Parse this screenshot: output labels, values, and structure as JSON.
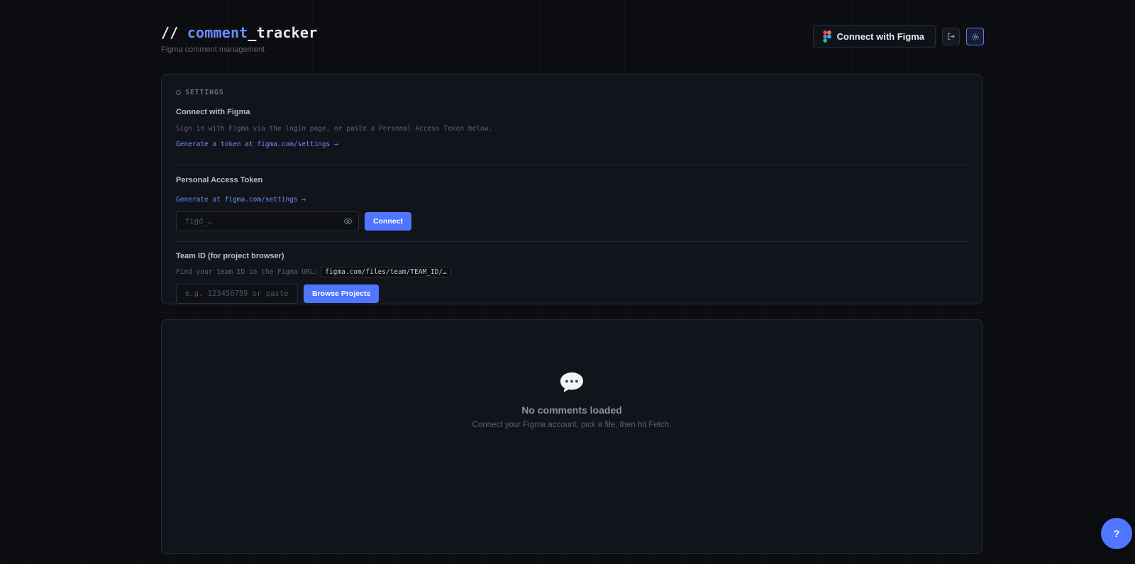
{
  "header": {
    "title_prefix": "// ",
    "title_accent": "comment",
    "title_suffix": "_tracker",
    "subtitle": "Figma comment management",
    "connect_label": "Connect with Figma",
    "icons": [
      "figma-logo",
      "logout-icon",
      "settings-gear-icon"
    ]
  },
  "settings": {
    "heading": "SETTINGS",
    "connect": {
      "label": "Connect with Figma",
      "description": "Sign in with Figma via the login page, or paste a Personal Access Token below.",
      "link": "Generate a token at figma.com/settings →"
    },
    "token": {
      "label": "Personal Access Token",
      "link": "Generate at figma.com/settings →",
      "placeholder": "figd_…",
      "button": "Connect"
    },
    "team": {
      "label": "Team ID (for project browser)",
      "hint": "Find your team ID in the Figma URL:",
      "url_example": "figma.com/files/team/TEAM_ID/…",
      "placeholder": "e.g. 123456789 or paste ",
      "button": "Browse Projects"
    }
  },
  "empty_state": {
    "icon": "speech-bubble-icon",
    "title": "No comments loaded",
    "subtitle": "Connect your Figma account, pick a file, then hit Fetch."
  },
  "help": {
    "label": "?"
  },
  "colors": {
    "accent": "#4f76ff",
    "background": "#0c0d11",
    "card": "#12141b"
  }
}
